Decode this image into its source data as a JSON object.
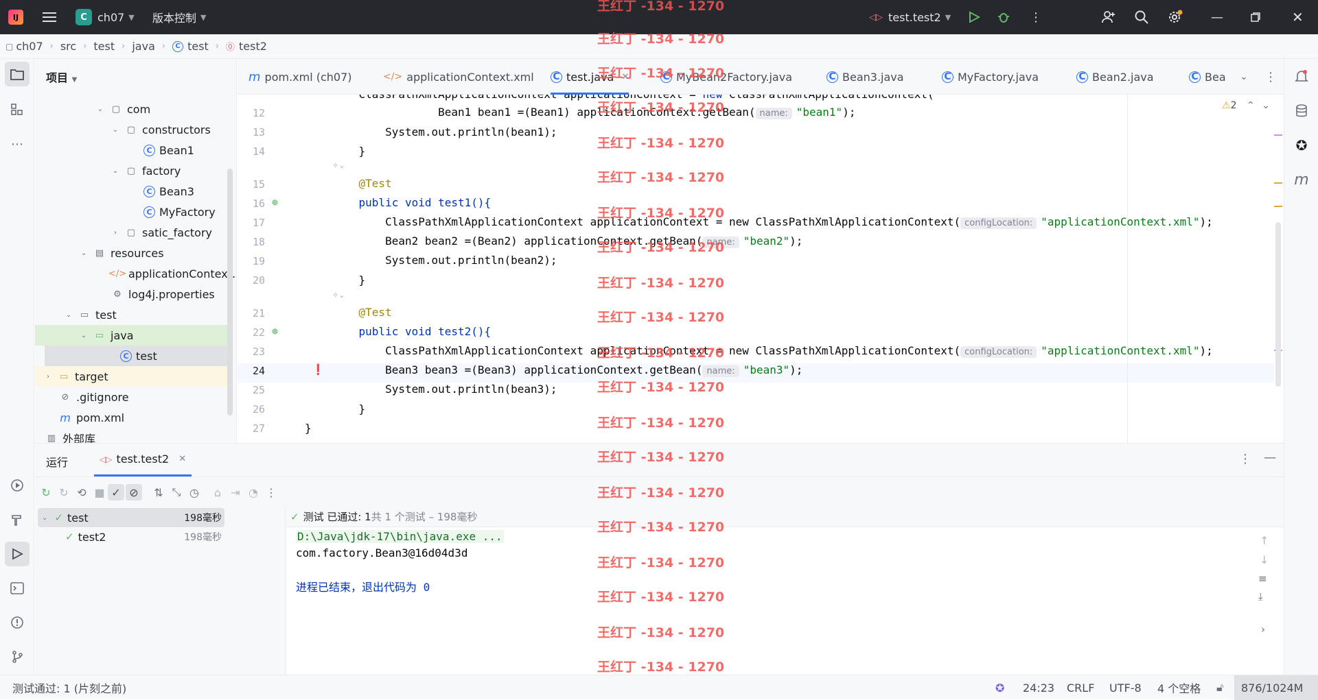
{
  "titlebar": {
    "project_badge": "C",
    "project": "ch07",
    "vcs": "版本控制",
    "run_config": "test.test2"
  },
  "breadcrumb": [
    "ch07",
    "src",
    "test",
    "java",
    "test",
    "test2"
  ],
  "project_panel": {
    "header": "项目",
    "rows": [
      {
        "label": "com",
        "type": "package"
      },
      {
        "label": "constructors",
        "type": "package"
      },
      {
        "label": "Bean1",
        "type": "class"
      },
      {
        "label": "factory",
        "type": "package"
      },
      {
        "label": "Bean3",
        "type": "class"
      },
      {
        "label": "MyFactory",
        "type": "class"
      },
      {
        "label": "satic_factory",
        "type": "package"
      },
      {
        "label": "resources",
        "type": "folder"
      },
      {
        "label": "applicationContext.x",
        "type": "xml"
      },
      {
        "label": "log4j.properties",
        "type": "props"
      },
      {
        "label": "test",
        "type": "folder"
      },
      {
        "label": "java",
        "type": "folder"
      },
      {
        "label": "test",
        "type": "class"
      },
      {
        "label": "target",
        "type": "folder"
      },
      {
        "label": ".gitignore",
        "type": "ignore"
      },
      {
        "label": "pom.xml",
        "type": "maven"
      },
      {
        "label": "外部库",
        "type": "lib"
      }
    ]
  },
  "tabs": [
    {
      "label": "pom.xml (ch07)",
      "icon": "m"
    },
    {
      "label": "applicationContext.xml",
      "icon": "xml"
    },
    {
      "label": "test.java",
      "icon": "C"
    },
    {
      "label": "MyBean2Factory.java",
      "icon": "C"
    },
    {
      "label": "Bean3.java",
      "icon": "C"
    },
    {
      "label": "MyFactory.java",
      "icon": "C"
    },
    {
      "label": "Bean2.java",
      "icon": "C"
    },
    {
      "label": "Bea",
      "icon": "C"
    }
  ],
  "editor": {
    "warning_count": "2",
    "lines": [
      {
        "n": "12",
        "code": "        Bean1 bean1 =(Bean1) applicationContext.getBean(",
        "hint": "name:",
        "str": "\"bean1\"",
        "tail": ");"
      },
      {
        "n": "13",
        "code": "        System.out.println(bean1);"
      },
      {
        "n": "14",
        "code": "    }"
      },
      {
        "n": "15",
        "code": "    @Test"
      },
      {
        "n": "16",
        "code": "    public void test1(){"
      },
      {
        "n": "17",
        "code": "        ClassPathXmlApplicationContext applicationContext = new ClassPathXmlApplicationContext(",
        "hint": "configLocation:",
        "str": "\"applicationContext.xml\"",
        "tail": ");"
      },
      {
        "n": "18",
        "code": "        Bean2 bean2 =(Bean2) applicationContext.getBean(",
        "hint": "name:",
        "str": "\"bean2\"",
        "tail": ");"
      },
      {
        "n": "19",
        "code": "        System.out.println(bean2);"
      },
      {
        "n": "20",
        "code": "    }"
      },
      {
        "n": "21",
        "code": "    @Test"
      },
      {
        "n": "22",
        "code": "    public void test2(){"
      },
      {
        "n": "23",
        "code": "        ClassPathXmlApplicationContext applicationContext = new ClassPathXmlApplicationContext(",
        "hint": "configLocation:",
        "str": "\"applicationContext.xml\"",
        "tail": ");"
      },
      {
        "n": "24",
        "code": "        Bean3 bean3 =(Bean3) applicationContext.getBean(",
        "hint": "name:",
        "str": "\"bean3\"",
        "tail": ");"
      },
      {
        "n": "25",
        "code": "        System.out.println(bean3);"
      },
      {
        "n": "26",
        "code": "    }"
      },
      {
        "n": "27",
        "code": "}"
      }
    ]
  },
  "run": {
    "title": "运行",
    "tab": "test.test2",
    "summary_prefix": "测试 已通过: 1",
    "summary_suffix": "共 1 个测试 – 198毫秒",
    "tree": [
      {
        "label": "test",
        "time": "198毫秒"
      },
      {
        "label": "test2",
        "time": "198毫秒"
      }
    ],
    "console": [
      "D:\\Java\\jdk-17\\bin\\java.exe ...",
      "com.factory.Bean3@16d04d3d",
      "",
      "进程已结束，退出代码为 0"
    ]
  },
  "status": {
    "left": "测试通过: 1 (片刻之前)",
    "pos": "24:23",
    "eol": "CRLF",
    "enc": "UTF-8",
    "indent": "4 个空格",
    "mem": "876/1024M"
  },
  "watermark": "王红丁 -134 - 1270"
}
